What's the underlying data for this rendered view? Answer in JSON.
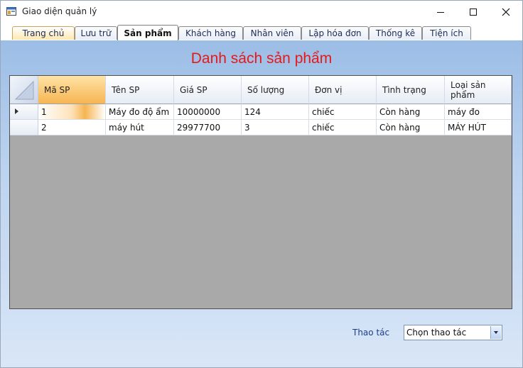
{
  "window": {
    "title": "Giao diện quản lý"
  },
  "tabs": [
    "Trang chủ",
    "Lưu trữ",
    "Sản phẩm",
    "Khách hàng",
    "Nhân viên",
    "Lập hóa đơn",
    "Thống kê",
    "Tiện ích"
  ],
  "active_tab": "Sản phẩm",
  "heading": "Danh sách sản phẩm",
  "grid": {
    "columns": [
      "Mã SP",
      "Tên SP",
      "Giá SP",
      "Số lượng",
      "Đơn vị",
      "Tình trạng",
      "Loại sản phẩm"
    ],
    "rows": [
      [
        "1",
        "Máy đo độ ẩm",
        "10000000",
        "124",
        "chiếc",
        "Còn hàng",
        "máy đo"
      ],
      [
        "2",
        "máy hút",
        "29977700",
        "3",
        "chiếc",
        "Còn hàng",
        "MÁY HÚT"
      ]
    ]
  },
  "actions": {
    "label": "Thao tác",
    "selected": "Chọn thao tác"
  },
  "icons": [
    "app-icon",
    "minimize-icon",
    "maximize-icon",
    "close-icon",
    "row-pointer-icon",
    "select-all-icon",
    "dropdown-arrow-icon"
  ],
  "colors": {
    "heading": "#e61919",
    "selected_header": "#f6b552",
    "grid_background": "#a9a9a9"
  }
}
